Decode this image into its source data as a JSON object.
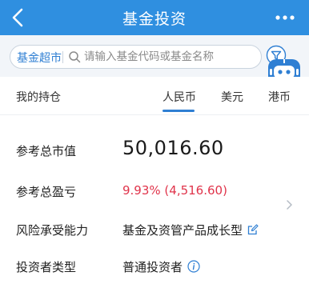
{
  "header": {
    "title": "基金投资",
    "back_icon": "chevron-left-icon",
    "more_icon": "more-dots-icon"
  },
  "search": {
    "label": "基金超市",
    "placeholder": "请输入基金代码或基金名称",
    "filter_icon": "filter-icon"
  },
  "assistant": {
    "icon": "robot-icon"
  },
  "holdings_tabs": {
    "title": "我的持仓",
    "tabs": [
      {
        "label": "人民币",
        "active": true
      },
      {
        "label": "美元",
        "active": false
      },
      {
        "label": "港币",
        "active": false
      }
    ]
  },
  "summary": {
    "market_value_label": "参考总市值",
    "market_value": "50,016.60",
    "profit_label": "参考总盈亏",
    "profit_value": "9.93% (4,516.60)",
    "risk_label": "风险承受能力",
    "risk_value": "基金及资管产品成长型",
    "investor_type_label": "投资者类型",
    "investor_type_value": "普通投资者"
  },
  "colors": {
    "header_bg": "#2f8fe0",
    "accent": "#2f7fd3",
    "profit": "#e0344b"
  }
}
